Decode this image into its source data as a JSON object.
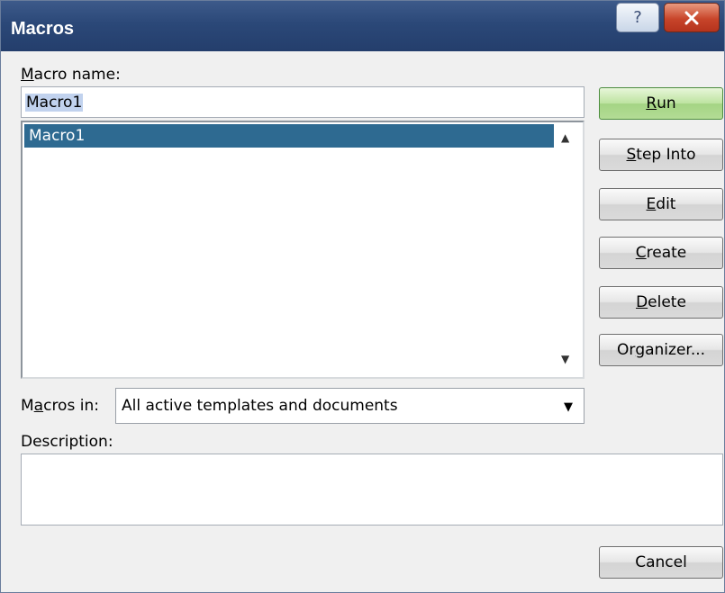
{
  "window": {
    "title": "Macros",
    "help_glyph": "?",
    "close_glyph": "✕"
  },
  "macro_name": {
    "label_accel": "M",
    "label_rest": "acro name:",
    "value": "Macro1"
  },
  "macro_list": {
    "items": [
      "Macro1"
    ],
    "selected_index": 0
  },
  "buttons": {
    "run": {
      "accel": "R",
      "rest": "un"
    },
    "step_into": {
      "accel": "S",
      "rest": "tep Into"
    },
    "edit": {
      "accel": "E",
      "rest": "dit"
    },
    "create": {
      "accel": "C",
      "rest": "reate"
    },
    "delete": {
      "accel": "D",
      "rest": "elete"
    },
    "organizer": {
      "pre": "Or",
      "accel": "g",
      "rest": "anizer..."
    },
    "cancel": "Cancel"
  },
  "macros_in": {
    "label_pre": "M",
    "label_accel": "a",
    "label_rest": "cros in:",
    "selected": "All active templates and documents"
  },
  "description": {
    "label": "Description:",
    "value": ""
  },
  "icons": {
    "scroll_up": "▲",
    "scroll_down": "▼",
    "dropdown": "▼"
  },
  "colors": {
    "titlebar": "#2b4878",
    "selection": "#2e6a91",
    "default_button": "#a4d484",
    "close_button": "#c8452a"
  }
}
